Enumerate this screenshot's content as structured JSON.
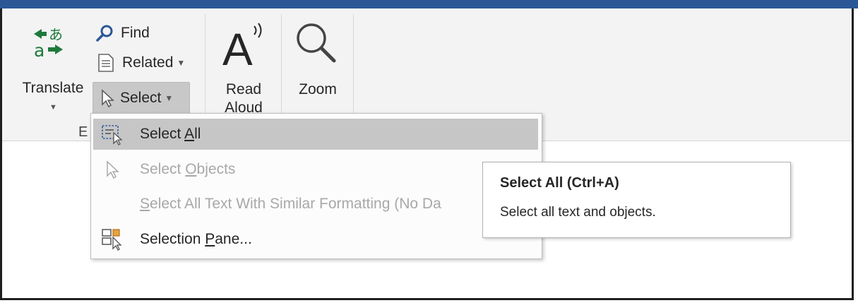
{
  "ribbon": {
    "translate": {
      "label": "Translate",
      "icon": "translate-icon"
    },
    "find": {
      "label": "Find",
      "icon": "search-icon"
    },
    "related": {
      "label": "Related",
      "icon": "document-icon"
    },
    "select": {
      "label": "Select",
      "icon": "cursor-icon"
    },
    "read_aloud": {
      "line1": "Read",
      "line2": "Aloud",
      "icon": "read-aloud-icon"
    },
    "zoom": {
      "label": "Zoom",
      "icon": "magnifier-icon"
    },
    "group_label": "E"
  },
  "select_menu": {
    "items": [
      {
        "pre": "Select ",
        "key": "A",
        "post": "ll",
        "state": "highlighted",
        "icon": "select-all-icon"
      },
      {
        "pre": "Select ",
        "key": "O",
        "post": "bjects",
        "state": "disabled",
        "icon": "cursor-icon"
      },
      {
        "pre": "",
        "key": "S",
        "post": "elect All Text With Similar Formatting (No Da",
        "state": "disabled",
        "icon": ""
      },
      {
        "pre": "Selection ",
        "key": "P",
        "post": "ane...",
        "state": "enabled",
        "icon": "selection-pane-icon"
      }
    ]
  },
  "tooltip": {
    "title": "Select All (Ctrl+A)",
    "description": "Select all text and objects."
  },
  "colors": {
    "title_bar": "#2b5797",
    "ribbon_bg": "#f3f3f3",
    "highlight": "#c6c6c6",
    "disabled_text": "#a8a8a8",
    "translate_icon": "#1e7a3c"
  }
}
